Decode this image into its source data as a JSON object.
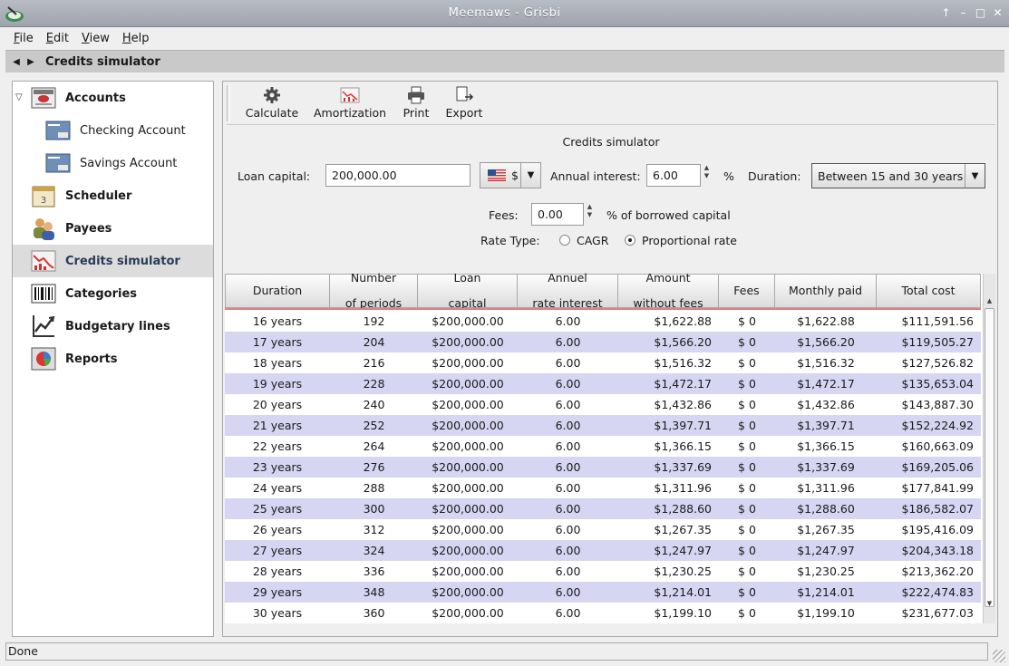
{
  "window": {
    "title": "Meemaws - Grisbi"
  },
  "menu": [
    {
      "accel": "F",
      "rest": "ile"
    },
    {
      "accel": "E",
      "rest": "dit"
    },
    {
      "accel": "V",
      "rest": "iew"
    },
    {
      "accel": "H",
      "rest": "elp"
    }
  ],
  "nav": {
    "title": "Credits simulator"
  },
  "sidebar": {
    "accounts": "Accounts",
    "checking": "Checking Account",
    "savings": "Savings Account",
    "scheduler": "Scheduler",
    "payees": "Payees",
    "credits": "Credits simulator",
    "categories": "Categories",
    "budgetary": "Budgetary lines",
    "reports": "Reports"
  },
  "toolbar": {
    "calculate": "Calculate",
    "amortization": "Amortization",
    "print": "Print",
    "export": "Export"
  },
  "form": {
    "title": "Credits simulator",
    "loan_capital_label": "Loan capital:",
    "loan_capital_value": "200,000.00",
    "currency": "$",
    "annual_interest_label": "Annual interest:",
    "annual_interest_value": "6.00",
    "percent": "%",
    "duration_label": "Duration:",
    "duration_value": "Between 15 and 30 years",
    "fees_label": "Fees:",
    "fees_value": "0.00",
    "fees_suffix": "% of borrowed capital",
    "rate_type_label": "Rate Type:",
    "rate_cagr": "CAGR",
    "rate_proportional": "Proportional rate"
  },
  "table": {
    "headers": [
      [
        "Duration"
      ],
      [
        "Number",
        "of periods"
      ],
      [
        "Loan",
        "capital"
      ],
      [
        "Annuel",
        "rate interest"
      ],
      [
        "Amount",
        "without fees"
      ],
      [
        "Fees"
      ],
      [
        "Monthly paid"
      ],
      [
        "Total cost"
      ]
    ],
    "rows": [
      [
        "16 years",
        "192",
        "$200,000.00",
        "6.00",
        "$1,622.88",
        "$ 0",
        "$1,622.88",
        "$111,591.56"
      ],
      [
        "17 years",
        "204",
        "$200,000.00",
        "6.00",
        "$1,566.20",
        "$ 0",
        "$1,566.20",
        "$119,505.27"
      ],
      [
        "18 years",
        "216",
        "$200,000.00",
        "6.00",
        "$1,516.32",
        "$ 0",
        "$1,516.32",
        "$127,526.82"
      ],
      [
        "19 years",
        "228",
        "$200,000.00",
        "6.00",
        "$1,472.17",
        "$ 0",
        "$1,472.17",
        "$135,653.04"
      ],
      [
        "20 years",
        "240",
        "$200,000.00",
        "6.00",
        "$1,432.86",
        "$ 0",
        "$1,432.86",
        "$143,887.30"
      ],
      [
        "21 years",
        "252",
        "$200,000.00",
        "6.00",
        "$1,397.71",
        "$ 0",
        "$1,397.71",
        "$152,224.92"
      ],
      [
        "22 years",
        "264",
        "$200,000.00",
        "6.00",
        "$1,366.15",
        "$ 0",
        "$1,366.15",
        "$160,663.09"
      ],
      [
        "23 years",
        "276",
        "$200,000.00",
        "6.00",
        "$1,337.69",
        "$ 0",
        "$1,337.69",
        "$169,205.06"
      ],
      [
        "24 years",
        "288",
        "$200,000.00",
        "6.00",
        "$1,311.96",
        "$ 0",
        "$1,311.96",
        "$177,841.99"
      ],
      [
        "25 years",
        "300",
        "$200,000.00",
        "6.00",
        "$1,288.60",
        "$ 0",
        "$1,288.60",
        "$186,582.07"
      ],
      [
        "26 years",
        "312",
        "$200,000.00",
        "6.00",
        "$1,267.35",
        "$ 0",
        "$1,267.35",
        "$195,416.09"
      ],
      [
        "27 years",
        "324",
        "$200,000.00",
        "6.00",
        "$1,247.97",
        "$ 0",
        "$1,247.97",
        "$204,343.18"
      ],
      [
        "28 years",
        "336",
        "$200,000.00",
        "6.00",
        "$1,230.25",
        "$ 0",
        "$1,230.25",
        "$213,362.20"
      ],
      [
        "29 years",
        "348",
        "$200,000.00",
        "6.00",
        "$1,214.01",
        "$ 0",
        "$1,214.01",
        "$222,474.83"
      ],
      [
        "30 years",
        "360",
        "$200,000.00",
        "6.00",
        "$1,199.10",
        "$ 0",
        "$1,199.10",
        "$231,677.03"
      ]
    ]
  },
  "status": {
    "text": "Done"
  },
  "colors": {
    "row_alt": "#d6d6f3",
    "header_line": "#e47d7d",
    "selected": "#dcdcdc"
  },
  "icons": [
    "app-icon",
    "accounts-icon",
    "account-card-icon",
    "scheduler-icon",
    "payees-icon",
    "credits-icon",
    "categories-icon",
    "budgetary-icon",
    "reports-icon",
    "gear-icon",
    "chart-icon",
    "printer-icon",
    "export-icon",
    "flag-icon"
  ]
}
